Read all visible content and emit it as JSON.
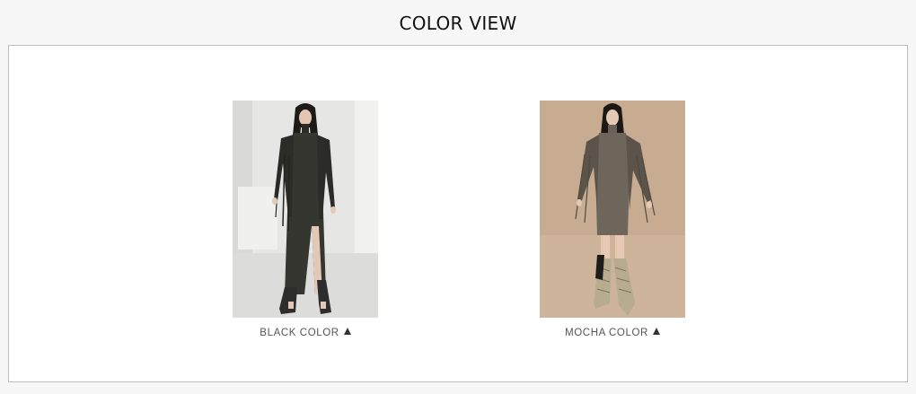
{
  "page": {
    "title": "COLOR VIEW"
  },
  "products": [
    {
      "caption": "BLACK COLOR",
      "icon": "triangle-up-icon",
      "photo": "model-black-dress-photo",
      "colors": {
        "background": "#e4e4e2",
        "dress": "#34362f",
        "boots": "#2d2d2d"
      }
    },
    {
      "caption": "MOCHA COLOR",
      "icon": "triangle-up-icon",
      "photo": "model-mocha-dress-photo",
      "colors": {
        "background": "#c6ab90",
        "dress": "#6e655b",
        "boots": "#b8ac8f"
      }
    }
  ]
}
